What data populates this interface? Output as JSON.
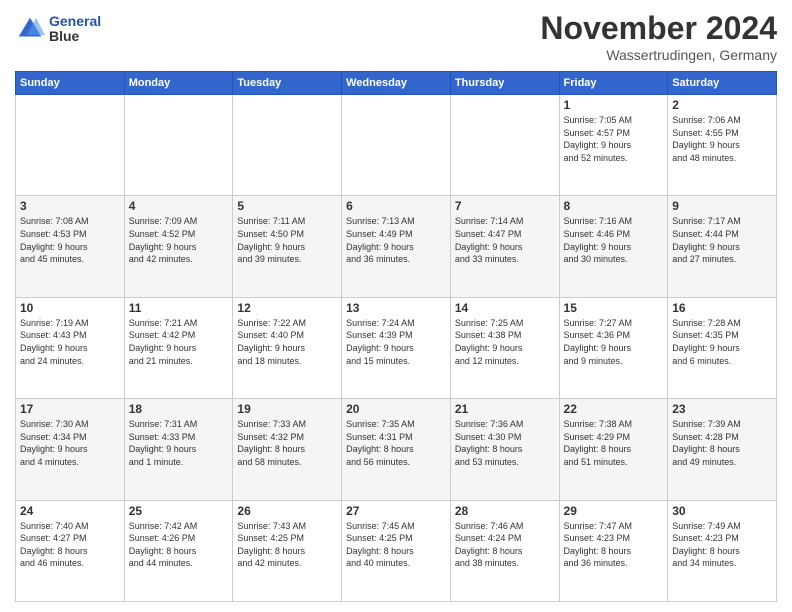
{
  "header": {
    "logo_line1": "General",
    "logo_line2": "Blue",
    "month": "November 2024",
    "location": "Wassertrudingen, Germany"
  },
  "weekdays": [
    "Sunday",
    "Monday",
    "Tuesday",
    "Wednesday",
    "Thursday",
    "Friday",
    "Saturday"
  ],
  "weeks": [
    [
      {
        "day": "",
        "info": ""
      },
      {
        "day": "",
        "info": ""
      },
      {
        "day": "",
        "info": ""
      },
      {
        "day": "",
        "info": ""
      },
      {
        "day": "",
        "info": ""
      },
      {
        "day": "1",
        "info": "Sunrise: 7:05 AM\nSunset: 4:57 PM\nDaylight: 9 hours\nand 52 minutes."
      },
      {
        "day": "2",
        "info": "Sunrise: 7:06 AM\nSunset: 4:55 PM\nDaylight: 9 hours\nand 48 minutes."
      }
    ],
    [
      {
        "day": "3",
        "info": "Sunrise: 7:08 AM\nSunset: 4:53 PM\nDaylight: 9 hours\nand 45 minutes."
      },
      {
        "day": "4",
        "info": "Sunrise: 7:09 AM\nSunset: 4:52 PM\nDaylight: 9 hours\nand 42 minutes."
      },
      {
        "day": "5",
        "info": "Sunrise: 7:11 AM\nSunset: 4:50 PM\nDaylight: 9 hours\nand 39 minutes."
      },
      {
        "day": "6",
        "info": "Sunrise: 7:13 AM\nSunset: 4:49 PM\nDaylight: 9 hours\nand 36 minutes."
      },
      {
        "day": "7",
        "info": "Sunrise: 7:14 AM\nSunset: 4:47 PM\nDaylight: 9 hours\nand 33 minutes."
      },
      {
        "day": "8",
        "info": "Sunrise: 7:16 AM\nSunset: 4:46 PM\nDaylight: 9 hours\nand 30 minutes."
      },
      {
        "day": "9",
        "info": "Sunrise: 7:17 AM\nSunset: 4:44 PM\nDaylight: 9 hours\nand 27 minutes."
      }
    ],
    [
      {
        "day": "10",
        "info": "Sunrise: 7:19 AM\nSunset: 4:43 PM\nDaylight: 9 hours\nand 24 minutes."
      },
      {
        "day": "11",
        "info": "Sunrise: 7:21 AM\nSunset: 4:42 PM\nDaylight: 9 hours\nand 21 minutes."
      },
      {
        "day": "12",
        "info": "Sunrise: 7:22 AM\nSunset: 4:40 PM\nDaylight: 9 hours\nand 18 minutes."
      },
      {
        "day": "13",
        "info": "Sunrise: 7:24 AM\nSunset: 4:39 PM\nDaylight: 9 hours\nand 15 minutes."
      },
      {
        "day": "14",
        "info": "Sunrise: 7:25 AM\nSunset: 4:38 PM\nDaylight: 9 hours\nand 12 minutes."
      },
      {
        "day": "15",
        "info": "Sunrise: 7:27 AM\nSunset: 4:36 PM\nDaylight: 9 hours\nand 9 minutes."
      },
      {
        "day": "16",
        "info": "Sunrise: 7:28 AM\nSunset: 4:35 PM\nDaylight: 9 hours\nand 6 minutes."
      }
    ],
    [
      {
        "day": "17",
        "info": "Sunrise: 7:30 AM\nSunset: 4:34 PM\nDaylight: 9 hours\nand 4 minutes."
      },
      {
        "day": "18",
        "info": "Sunrise: 7:31 AM\nSunset: 4:33 PM\nDaylight: 9 hours\nand 1 minute."
      },
      {
        "day": "19",
        "info": "Sunrise: 7:33 AM\nSunset: 4:32 PM\nDaylight: 8 hours\nand 58 minutes."
      },
      {
        "day": "20",
        "info": "Sunrise: 7:35 AM\nSunset: 4:31 PM\nDaylight: 8 hours\nand 56 minutes."
      },
      {
        "day": "21",
        "info": "Sunrise: 7:36 AM\nSunset: 4:30 PM\nDaylight: 8 hours\nand 53 minutes."
      },
      {
        "day": "22",
        "info": "Sunrise: 7:38 AM\nSunset: 4:29 PM\nDaylight: 8 hours\nand 51 minutes."
      },
      {
        "day": "23",
        "info": "Sunrise: 7:39 AM\nSunset: 4:28 PM\nDaylight: 8 hours\nand 49 minutes."
      }
    ],
    [
      {
        "day": "24",
        "info": "Sunrise: 7:40 AM\nSunset: 4:27 PM\nDaylight: 8 hours\nand 46 minutes."
      },
      {
        "day": "25",
        "info": "Sunrise: 7:42 AM\nSunset: 4:26 PM\nDaylight: 8 hours\nand 44 minutes."
      },
      {
        "day": "26",
        "info": "Sunrise: 7:43 AM\nSunset: 4:25 PM\nDaylight: 8 hours\nand 42 minutes."
      },
      {
        "day": "27",
        "info": "Sunrise: 7:45 AM\nSunset: 4:25 PM\nDaylight: 8 hours\nand 40 minutes."
      },
      {
        "day": "28",
        "info": "Sunrise: 7:46 AM\nSunset: 4:24 PM\nDaylight: 8 hours\nand 38 minutes."
      },
      {
        "day": "29",
        "info": "Sunrise: 7:47 AM\nSunset: 4:23 PM\nDaylight: 8 hours\nand 36 minutes."
      },
      {
        "day": "30",
        "info": "Sunrise: 7:49 AM\nSunset: 4:23 PM\nDaylight: 8 hours\nand 34 minutes."
      }
    ]
  ]
}
